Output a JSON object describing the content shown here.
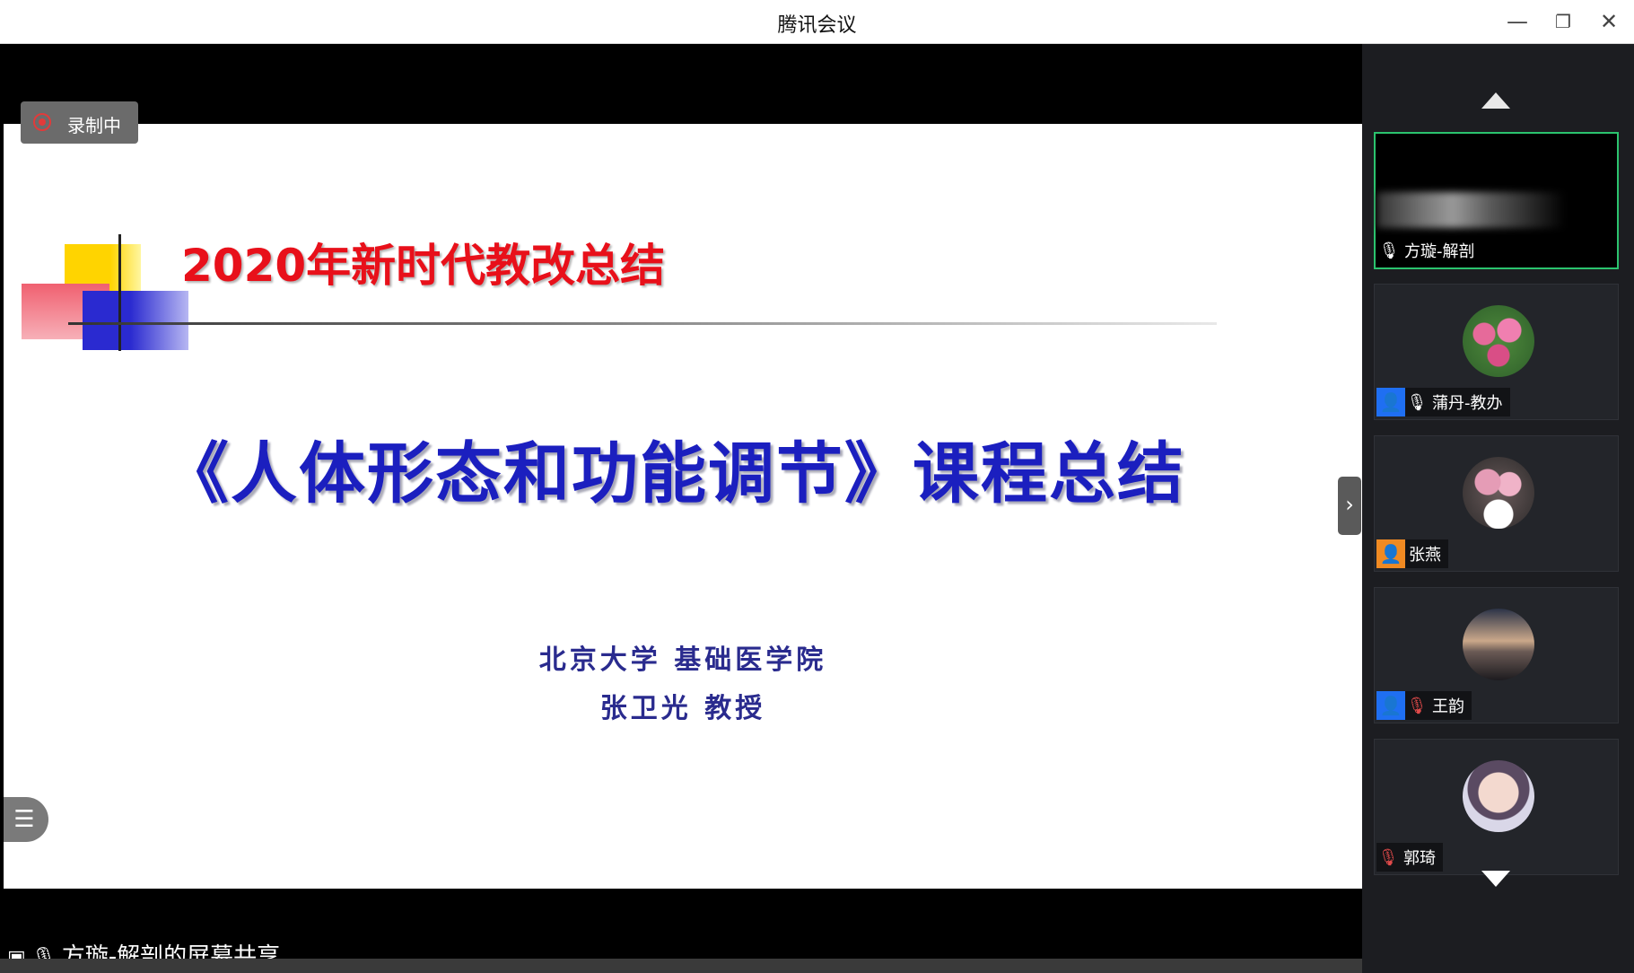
{
  "window": {
    "title": "腾讯会议",
    "minimize_glyph": "—",
    "restore_glyph": "❐",
    "close_glyph": "✕"
  },
  "recording": {
    "label": "录制中"
  },
  "slide": {
    "title": "2020年新时代教改总结",
    "course_title": "《人体形态和功能调节》课程总结",
    "institution": "北京大学 基础医学院",
    "presenter": "张卫光 教授"
  },
  "share": {
    "label": "方璇-解剖的屏幕共享"
  },
  "participants": [
    {
      "name": "方璇-解剖",
      "icon": "mic-icon",
      "muted": false,
      "active": true
    },
    {
      "name": "蒲丹-教办",
      "icon": "mic-icon",
      "muted": false,
      "badge": "blue"
    },
    {
      "name": "张燕",
      "badge": "orange"
    },
    {
      "name": "王韵",
      "icon": "mic-muted-icon",
      "muted": true,
      "badge": "blue"
    },
    {
      "name": "郭琦",
      "icon": "mic-muted-icon",
      "muted": true
    }
  ],
  "colors": {
    "title_red": "#e8101a",
    "course_blue": "#1b1fbf",
    "active_border": "#2bc36e",
    "badge_blue": "#1f6ff2",
    "badge_orange": "#f08a22"
  }
}
